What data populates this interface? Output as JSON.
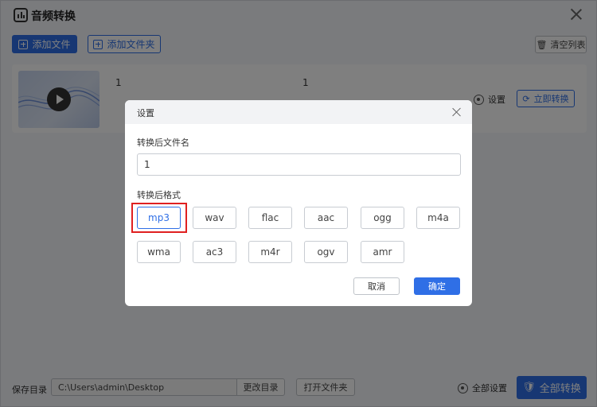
{
  "app": {
    "title": "音频转换"
  },
  "toolbar": {
    "add_file": "添加文件",
    "add_folder": "添加文件夹",
    "clear_list": "清空列表"
  },
  "file": {
    "source_name": "1",
    "target_name": "1",
    "settings_label": "设置",
    "convert_now": "立即转换"
  },
  "dialog": {
    "title": "设置",
    "filename_label": "转换后文件名",
    "filename_value": "1",
    "format_label": "转换后格式",
    "formats": [
      "mp3",
      "wav",
      "flac",
      "aac",
      "ogg",
      "m4a",
      "wma",
      "ac3",
      "m4r",
      "ogv",
      "amr"
    ],
    "selected_format": "mp3",
    "cancel": "取消",
    "confirm": "确定"
  },
  "footer": {
    "save_dir_label": "保存目录",
    "save_dir_value": "C:\\Users\\admin\\Desktop",
    "change_dir": "更改目录",
    "open_folder": "打开文件夹",
    "all_settings": "全部设置",
    "convert_all": "全部转换"
  },
  "colors": {
    "accent": "#2f6fe6",
    "highlight": "#e02020"
  }
}
